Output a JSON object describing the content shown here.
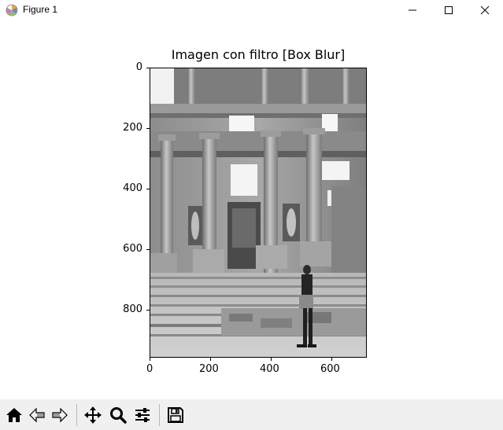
{
  "window": {
    "title": "Figure 1",
    "controls": [
      "minimize",
      "maximize",
      "close"
    ]
  },
  "figure": {
    "title": "Imagen con filtro [Box Blur]",
    "image_description_icon": "grayscale-photo-library-of-celsus-with-person",
    "y_ticks": [
      "0",
      "200",
      "400",
      "600",
      "800"
    ],
    "x_ticks": [
      "0",
      "200",
      "400",
      "600"
    ]
  },
  "toolbar": {
    "buttons": [
      {
        "name": "home-icon"
      },
      {
        "name": "back-arrow-icon"
      },
      {
        "name": "forward-arrow-icon"
      },
      {
        "name": "pan-move-icon"
      },
      {
        "name": "zoom-magnifier-icon"
      },
      {
        "name": "configure-subplots-icon"
      },
      {
        "name": "save-floppy-icon"
      }
    ]
  },
  "colors": {
    "toolbar_bg": "#f0f0f0",
    "window_bg": "#ffffff",
    "axes_border": "#000000"
  }
}
